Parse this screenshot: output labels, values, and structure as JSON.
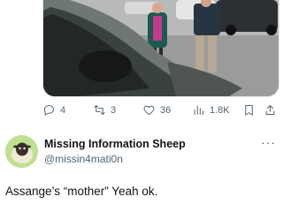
{
  "tweet_actions": {
    "reply_count": "4",
    "retweet_count": "3",
    "like_count": "36",
    "view_count": "1.8K"
  },
  "author": {
    "display_name": "Missing Information Sheep",
    "handle": "@missin4mati0n",
    "more_label": "···"
  },
  "tweet": {
    "text": "Assange’s “mother”  Yeah ok."
  },
  "icons": {
    "reply": "reply-icon",
    "retweet": "retweet-icon",
    "like": "heart-icon",
    "views": "views-icon",
    "bookmark": "bookmark-icon",
    "share": "share-icon"
  }
}
